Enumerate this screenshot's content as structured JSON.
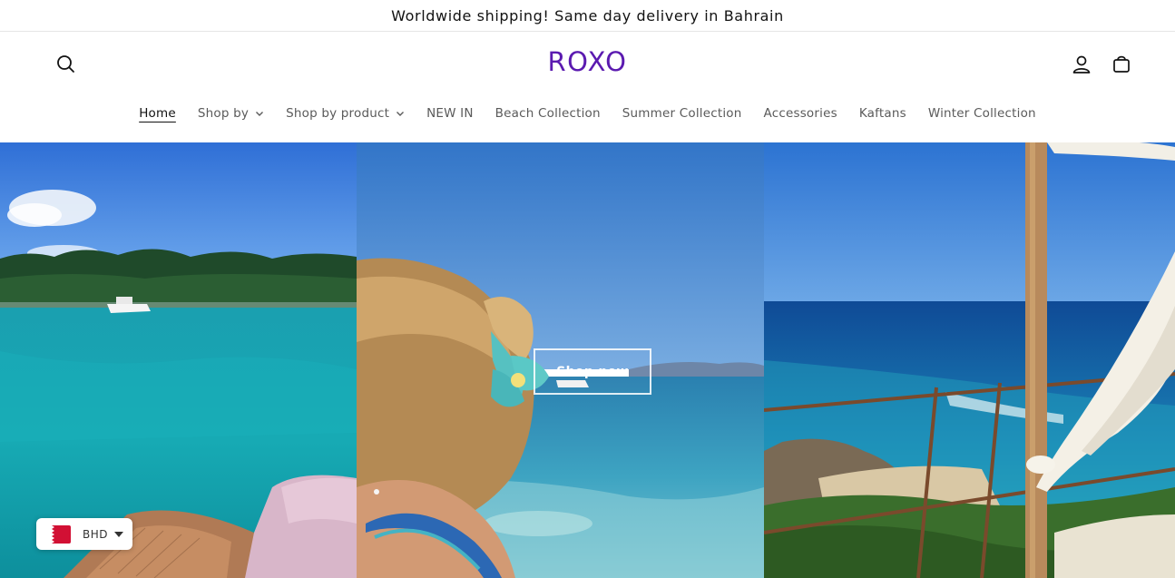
{
  "announcement": {
    "text": "Worldwide shipping! Same day delivery in Bahrain"
  },
  "header": {
    "logo": "ROXO",
    "icons": {
      "search": "search-icon",
      "account": "user-icon",
      "cart": "cart-icon"
    },
    "brand_color": "#5b1ab0"
  },
  "nav": {
    "items": [
      {
        "label": "Home",
        "active": true,
        "dropdown": false
      },
      {
        "label": "Shop by",
        "active": false,
        "dropdown": true
      },
      {
        "label": "Shop by product",
        "active": false,
        "dropdown": true
      },
      {
        "label": "NEW IN",
        "active": false,
        "dropdown": false
      },
      {
        "label": "Beach Collection",
        "active": false,
        "dropdown": false
      },
      {
        "label": "Summer Collection",
        "active": false,
        "dropdown": false
      },
      {
        "label": "Accessories",
        "active": false,
        "dropdown": false
      },
      {
        "label": "Kaftans",
        "active": false,
        "dropdown": false
      },
      {
        "label": "Winter Collection",
        "active": false,
        "dropdown": false
      }
    ]
  },
  "hero": {
    "button_label": "Shop now"
  },
  "currency": {
    "code": "BHD",
    "flag": "bahrain-flag-icon"
  }
}
